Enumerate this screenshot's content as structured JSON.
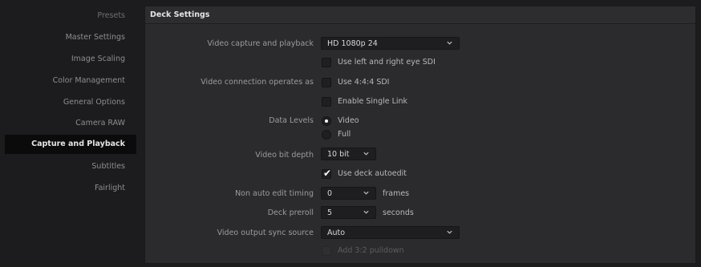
{
  "sidebar": {
    "items": [
      {
        "label": "Presets"
      },
      {
        "label": "Master Settings"
      },
      {
        "label": "Image Scaling"
      },
      {
        "label": "Color Management"
      },
      {
        "label": "General Options"
      },
      {
        "label": "Camera RAW"
      },
      {
        "label": "Capture and Playback"
      },
      {
        "label": "Subtitles"
      },
      {
        "label": "Fairlight"
      }
    ],
    "active": "Capture and Playback"
  },
  "panel": {
    "title": "Deck Settings",
    "video_capture": {
      "label": "Video capture and playback",
      "value": "HD 1080p 24"
    },
    "left_right_eye": {
      "label": "Use left and right eye SDI",
      "checked": false
    },
    "connection": {
      "label": "Video connection operates as",
      "option_label": "Use 4:4:4 SDI",
      "checked": false
    },
    "single_link": {
      "label": "Enable Single Link",
      "checked": false
    },
    "data_levels": {
      "label": "Data Levels",
      "options": [
        "Video",
        "Full"
      ],
      "selected": "Video"
    },
    "bit_depth": {
      "label": "Video bit depth",
      "value": "10 bit"
    },
    "deck_autoedit": {
      "label": "Use deck autoedit",
      "checked": true
    },
    "non_auto_edit": {
      "label": "Non auto edit timing",
      "value": "0",
      "unit": "frames"
    },
    "deck_preroll": {
      "label": "Deck preroll",
      "value": "5",
      "unit": "seconds"
    },
    "output_sync": {
      "label": "Video output sync source",
      "value": "Auto"
    },
    "pulldown": {
      "label": "Add 3:2 pulldown",
      "checked": false,
      "enabled": false
    }
  },
  "icons": {
    "chevron": "chevron-down-icon",
    "check": "checkmark-icon"
  }
}
